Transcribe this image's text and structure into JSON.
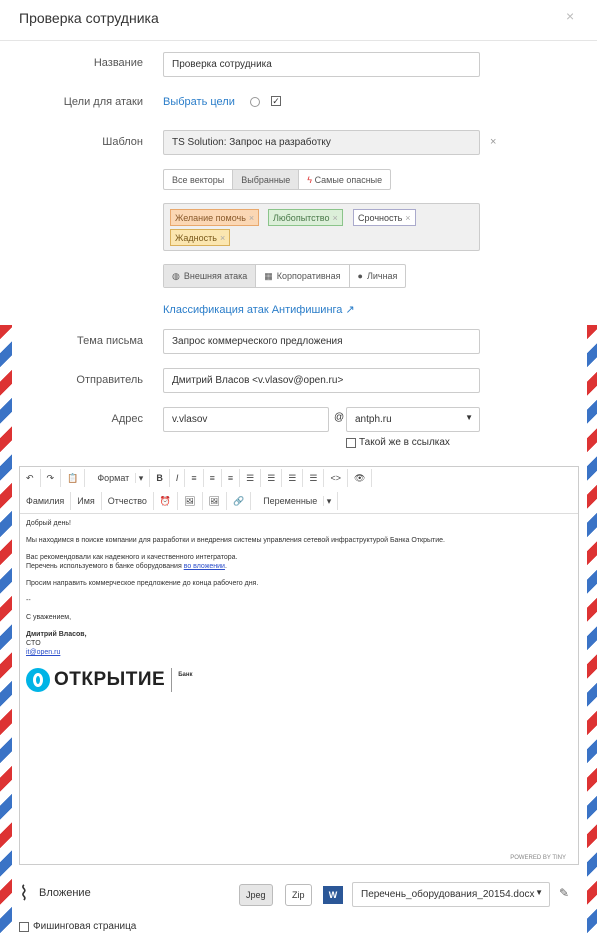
{
  "dialog": {
    "title": "Проверка сотрудника",
    "close": "×"
  },
  "form": {
    "name_label": "Название",
    "name_value": "Проверка сотрудника",
    "targets_label": "Цели для атаки",
    "targets_link": "Выбрать цели",
    "template_label": "Шаблон",
    "template_value": "TS Solution: Запрос на разработку",
    "template_clear": "×",
    "vectors": [
      "Все векторы",
      "Выбранные",
      "Самые опасные"
    ],
    "tags": [
      "Желание помочь",
      "Любопытство",
      "Срочность",
      "Жадность"
    ],
    "attack_types": [
      "Внешняя атака",
      "Корпоративная",
      "Личная"
    ],
    "classification_link": "Классификация атак Антифишинга",
    "subject_label": "Тема письма",
    "subject_value": "Запрос коммерческого предложения",
    "sender_label": "Отправитель",
    "sender_value": "Дмитрий Власов <v.vlasov@open.ru>",
    "address_label": "Адрес",
    "address_user": "v.vlasov",
    "at": "@",
    "address_domain": "antph.ru",
    "same_links": "Такой же в ссылках"
  },
  "editor": {
    "toolbar1": [
      "↶",
      "↷",
      "📋",
      "Формат",
      "B",
      "I",
      "≡",
      "≡",
      "≡",
      "☰",
      "☰",
      "☰",
      "☰",
      "<>",
      "👁"
    ],
    "toolbar2": [
      "Фамилия",
      "Имя",
      "Отчество",
      "⏰",
      "🖼",
      "🖼",
      "🔗",
      "Переменные"
    ],
    "greeting": "Добрый день!",
    "p1": "Мы находимся в поиске компании для разработки и внедрения системы управления сетевой инфраструктурой Банка Открытие.",
    "p2a": "Вас рекомендовали как надежного и качественного интегратора.",
    "p2b": "Перечень используемого в банке оборудования ",
    "p2link": "во вложении",
    "p3": "Просим направить коммерческое предложение до конца рабочего дня.",
    "sep": "--",
    "regards": "С уважением,",
    "sig_name": "Дмитрий Власов,",
    "sig_title": "CTO",
    "sig_email": "it@open.ru",
    "logo_text": "ОТКРЫТИЕ",
    "logo_sub": "Банк",
    "powered": "POWERED BY TINY"
  },
  "attach": {
    "label": "Вложение",
    "jpeg": "Jpeg",
    "zip": "Zip",
    "file": "Перечень_оборудования_20154.docx",
    "phishing": "Фишинговая страница"
  }
}
